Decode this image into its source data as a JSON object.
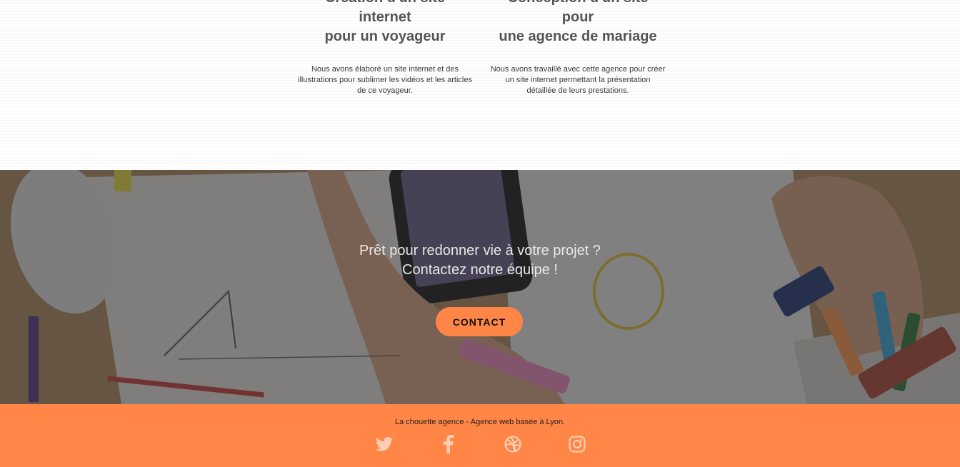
{
  "portfolio": {
    "cards": [
      {
        "title_line1": "Création d'un site internet",
        "title_line2": "pour un voyageur",
        "description": "Nous avons élaboré un site internet et des illustrations pour sublimer les vidéos et les articles de ce voyageur."
      },
      {
        "title_line1": "Conception d'un site pour",
        "title_line2": "une agence de mariage",
        "description": "Nous avons travaillé avec cette agence pour créer un site internet permettant la présentation détaillée de leurs prestations."
      }
    ]
  },
  "contact": {
    "line1": "Prêt pour redonner vie à votre projet ?",
    "line2": "Contactez notre équipe !",
    "button_label": "CONTACT"
  },
  "footer": {
    "text": "La chouette agence - Agence web basée à Lyon.",
    "social": [
      {
        "icon": "twitter-icon"
      },
      {
        "icon": "facebook-icon"
      },
      {
        "icon": "dribbble-icon"
      },
      {
        "icon": "instagram-icon"
      }
    ]
  },
  "colors": {
    "accent": "#ff8646",
    "heading": "#555555",
    "overlay": "#282828"
  }
}
